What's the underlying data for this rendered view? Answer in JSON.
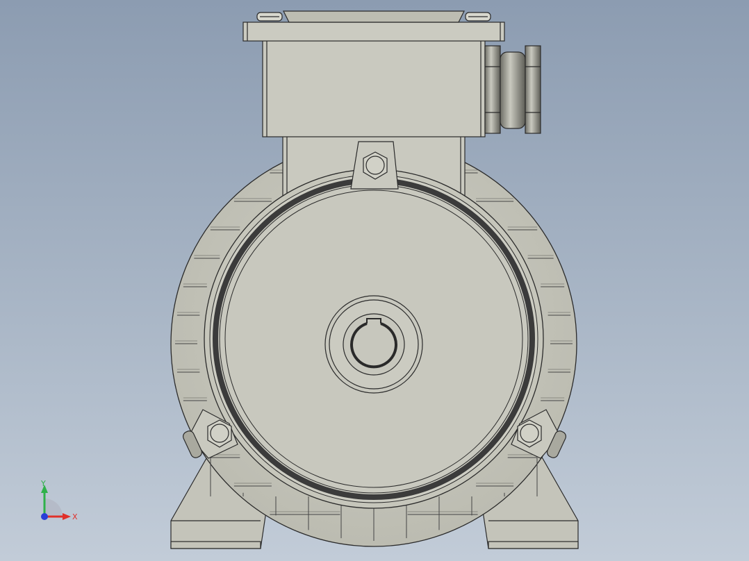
{
  "triad": {
    "x_label": "X",
    "y_label": "Y",
    "x_color": "#e0302a",
    "y_color": "#2fb14a",
    "z_color": "#2a3fd8"
  },
  "model": {
    "body_color": "#c9c9bf",
    "body_shade": "#b7b7ac",
    "edge_color": "#2a2a2a",
    "cable_gland_color": "#8d8d84"
  }
}
